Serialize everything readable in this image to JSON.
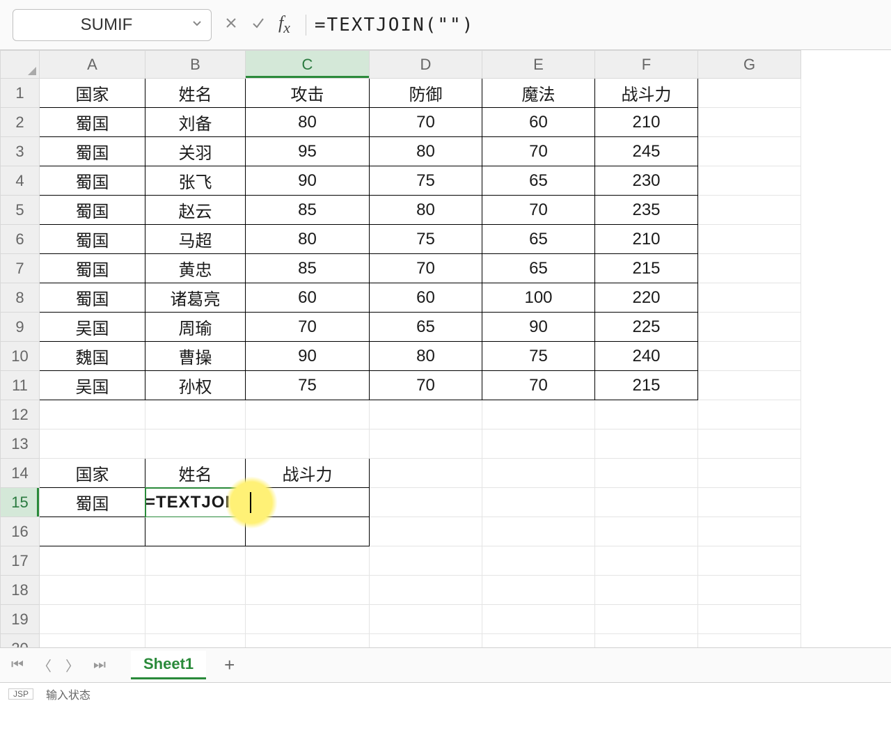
{
  "nameBox": "SUMIF",
  "formulaBar": "=TEXTJOIN(\"\")",
  "columns": [
    "A",
    "B",
    "C",
    "D",
    "E",
    "F",
    "G"
  ],
  "rowCount": 20,
  "activeCol": "C",
  "activeRow": 15,
  "headers": [
    "国家",
    "姓名",
    "攻击",
    "防御",
    "魔法",
    "战斗力"
  ],
  "data": [
    [
      "蜀国",
      "刘备",
      "80",
      "70",
      "60",
      "210"
    ],
    [
      "蜀国",
      "关羽",
      "95",
      "80",
      "70",
      "245"
    ],
    [
      "蜀国",
      "张飞",
      "90",
      "75",
      "65",
      "230"
    ],
    [
      "蜀国",
      "赵云",
      "85",
      "80",
      "70",
      "235"
    ],
    [
      "蜀国",
      "马超",
      "80",
      "75",
      "65",
      "210"
    ],
    [
      "蜀国",
      "黄忠",
      "85",
      "70",
      "65",
      "215"
    ],
    [
      "蜀国",
      "诸葛亮",
      "60",
      "60",
      "100",
      "220"
    ],
    [
      "吴国",
      "周瑜",
      "70",
      "65",
      "90",
      "225"
    ],
    [
      "魏国",
      "曹操",
      "90",
      "80",
      "75",
      "240"
    ],
    [
      "吴国",
      "孙权",
      "75",
      "70",
      "70",
      "215"
    ]
  ],
  "lookup": {
    "headers": [
      "国家",
      "姓名",
      "战斗力"
    ],
    "key": "蜀国"
  },
  "editingDisplay": "=TEXTJOIN(\"\")",
  "sheetTab": "Sheet1",
  "status": {
    "jsp": "JSP",
    "mode": "输入状态"
  }
}
